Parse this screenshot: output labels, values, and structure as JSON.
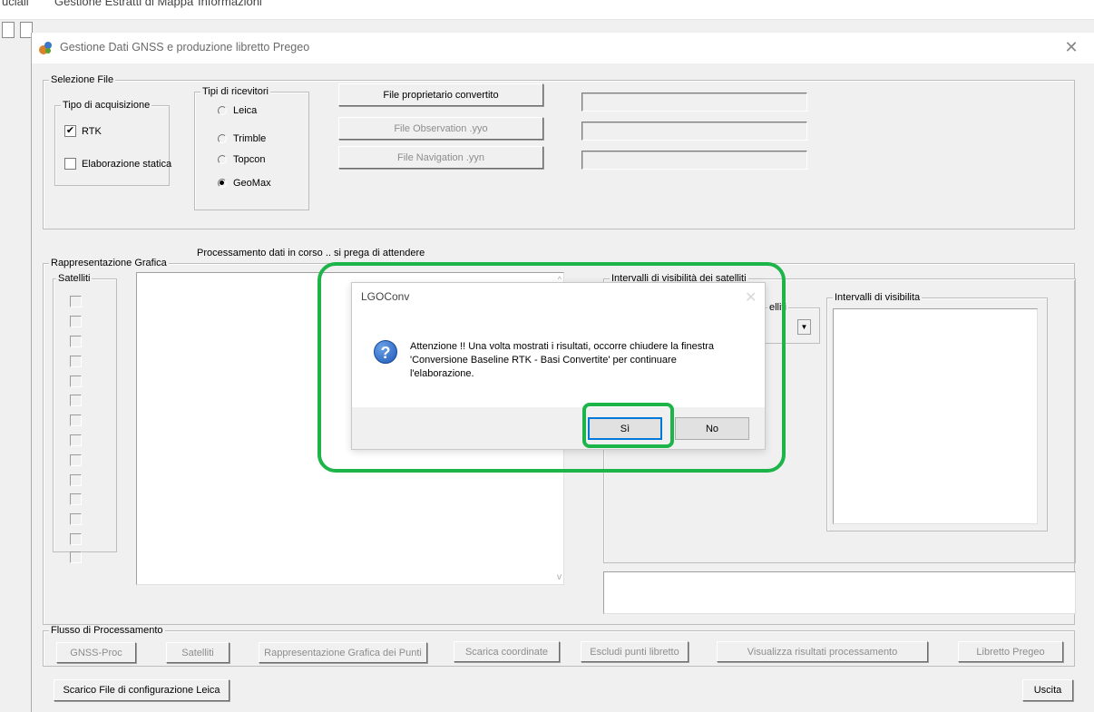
{
  "colors": {
    "highlight": "#1db54a",
    "dialog_icon": "#1f58b6",
    "default_button_border": "#0078d7"
  },
  "background_app": {
    "menu_items": [
      "uciali",
      "Gestione Estratti di Mappa",
      "Informazioni"
    ]
  },
  "window": {
    "title": "Gestione Dati GNSS e produzione libretto Pregeo",
    "close_glyph": "✕"
  },
  "selezione_file": {
    "legend": "Selezione File",
    "tipo_acquisizione": {
      "legend": "Tipo di acquisizione",
      "rtk_label": "RTK",
      "rtk_checked": true,
      "statica_label": "Elaborazione statica",
      "statica_checked": false
    },
    "tipi_ricevitori": {
      "legend": "Tipi di ricevitori",
      "options": [
        "Leica",
        "Trimble",
        "Topcon",
        "GeoMax"
      ],
      "selected": "GeoMax"
    },
    "buttons": {
      "proprietario": "File proprietario convertito",
      "observation": "File Observation .yyo",
      "navigation": "File Navigation .yyn"
    },
    "fields": [
      "",
      "",
      ""
    ]
  },
  "status_text": "Processamento dati in corso .. si prega di attendere",
  "rappresentazione": {
    "legend": "Rappresentazione Grafica",
    "satelliti_legend": "Satelliti",
    "satellite_checkbox_count": 14
  },
  "intervalli_group": {
    "legend": "Intervalli di visibilità dei satelliti",
    "satelliti_combo_label_fragment": "elliti",
    "intervalli_legend": "Intervalli di visibilita"
  },
  "flusso": {
    "legend": "Flusso di Processamento",
    "buttons": [
      "GNSS-Proc",
      "Satelliti",
      "Rappresentazione Grafica dei Punti",
      "Scarica coordinate",
      "Escludi punti libretto",
      "Visualizza risultati processamento",
      "Libretto Pregeo"
    ]
  },
  "bottom": {
    "scarico_button": "Scarico File di configurazione Leica",
    "uscita_button": "Uscita"
  },
  "dialog": {
    "title": "LGOConv",
    "close_glyph": "✕",
    "icon_glyph": "?",
    "message": "Attenzione !! Una volta mostrati i risultati, occorre chiudere la finestra\n'Conversione Baseline RTK - Basi Convertite' per continuare\nl'elaborazione.",
    "yes_label": "Sì",
    "no_label": "No"
  }
}
